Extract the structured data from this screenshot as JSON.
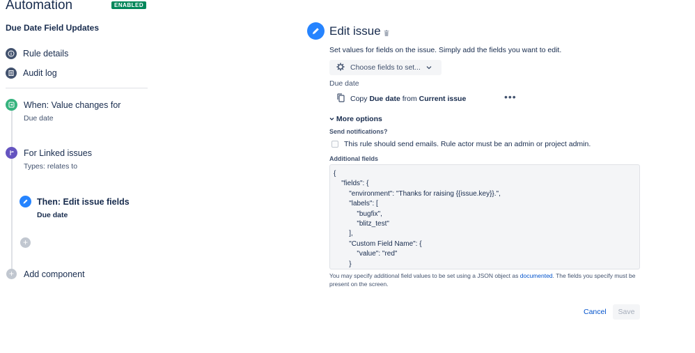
{
  "header": {
    "title": "Automation",
    "status_badge": "ENABLED",
    "rule_name": "Due Date Field Updates"
  },
  "nav": {
    "rule_details": "Rule details",
    "audit_log": "Audit log"
  },
  "timeline": {
    "trigger_title": "When: Value changes for",
    "trigger_sub": "Due date",
    "branch_title": "For Linked issues",
    "branch_sub": "Types: relates to",
    "action_title": "Then: Edit issue fields",
    "action_sub": "Due date",
    "add_component": "Add component"
  },
  "editor": {
    "title": "Edit issue",
    "description": "Set values for fields on the issue. Simply add the fields you want to edit.",
    "choose_fields": "Choose fields to set...",
    "field_label": "Due date",
    "copy_prefix": "Copy",
    "copy_field": "Due date",
    "copy_from": "from",
    "copy_source": "Current issue",
    "more_menu": "•••",
    "more_options": "More options",
    "send_notifications_label": "Send notifications?",
    "send_notifications_text": "This rule should send emails. Rule actor must be an admin or project admin.",
    "additional_fields_label": "Additional fields",
    "additional_fields_json": "{\n    \"fields\": {\n        \"environment\": \"Thanks for raising {{issue.key}}.\",\n        \"labels\": [\n            \"bugfix\",\n            \"blitz_test\"\n        ],\n        \"Custom Field Name\": {\n            \"value\": \"red\"\n        }",
    "help_prefix": "You may specify additional field values to be set using a JSON object as ",
    "help_link": "documented",
    "help_suffix": ". The fields you specify must be present on the screen.",
    "cancel": "Cancel",
    "save": "Save"
  },
  "colors": {
    "enabled_badge": "#00875A",
    "trigger_icon": "#36B37E",
    "branch_icon": "#6554C0",
    "action_icon": "#2684FF",
    "link": "#0052CC"
  }
}
